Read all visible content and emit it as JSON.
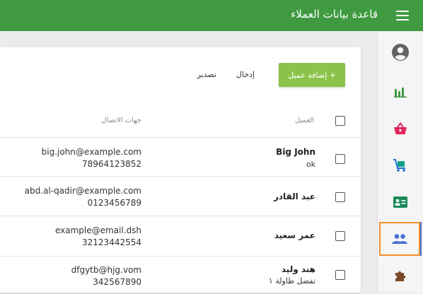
{
  "app": {
    "title": "قاعدة بيانات العملاء",
    "accent": "#3f9a41",
    "active_highlight": "#f0902b"
  },
  "sidebar": {
    "items": [
      {
        "icon": "account-circle-icon"
      },
      {
        "icon": "bar-chart-icon"
      },
      {
        "icon": "basket-icon"
      },
      {
        "icon": "cart-icon"
      },
      {
        "icon": "contact-card-icon"
      },
      {
        "icon": "people-icon",
        "active": true
      },
      {
        "icon": "puzzle-icon"
      }
    ]
  },
  "toolbar": {
    "add_label": "+ إضافة عميل",
    "import_label": "إدخال",
    "export_label": "تصدير"
  },
  "table": {
    "headers": {
      "client": "العميل",
      "contacts": "جهات الاتصال"
    },
    "rows": [
      {
        "name": "Big John",
        "sub": "ok",
        "email": "big.john@example.com",
        "phone": "78964123852"
      },
      {
        "name": "عبد القادر",
        "sub": "",
        "email": "abd.al-qadir@example.com",
        "phone": "0123456789"
      },
      {
        "name": "عمر سعيد",
        "sub": "",
        "email": "example@email.dsh",
        "phone": "32123442554"
      },
      {
        "name": "هند وليد",
        "sub": "تفضل طاولة ١",
        "email": "dfgytb@hjg.vom",
        "phone": "342567890"
      }
    ]
  }
}
